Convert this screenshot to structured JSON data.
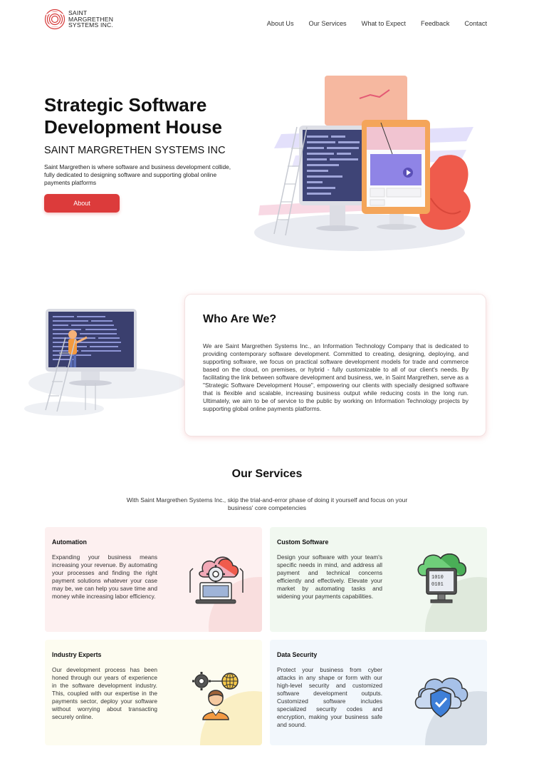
{
  "brand": {
    "line1": "SAINT",
    "line2": "MARGRETHEN",
    "line3": "SYSTEMS INC."
  },
  "nav": {
    "items": [
      "About Us",
      "Our Services",
      "What to Expect",
      "Feedback",
      "Contact"
    ]
  },
  "hero": {
    "title": "Strategic Software Development House",
    "subtitle": "SAINT MARGRETHEN SYSTEMS INC",
    "description": "Saint Margrethen is where software and business development collide, fully dedicated to designing software and supporting global online payments platforms",
    "button_label": "About"
  },
  "who": {
    "title": "Who Are We?",
    "text": "We are Saint Margrethen Systems Inc., an Information Technology Company that is dedicated to providing contemporary software development. Committed to creating, designing, deploying, and supporting software, we focus on practical software development models for trade and commerce based on the cloud, on premises, or hybrid - fully customizable to all of our client's needs. By facilitating the link between software development and business, we, in Saint Margrethen, serve as a \"Strategic Software Development House\", empowering our clients with specially designed software that is flexible and scalable, increasing business output while reducing costs in the long run. Ultimately, we aim to be of service to the public by working on Information Technology projects by supporting global online payments platforms."
  },
  "services": {
    "title": "Our Services",
    "subtitle": "With Saint Margrethen Systems Inc., skip the trial-and-error phase of doing it yourself and focus on your business' core competencies",
    "cards": [
      {
        "title": "Automation",
        "text": "Expanding your business means increasing your revenue. By automating your processes and finding the right payment solutions whatever your case may be, we can help you save time and money while increasing labor efficiency.",
        "icon": "cloud-gear-laptop-icon",
        "accent": "#f7d5d5"
      },
      {
        "title": "Custom Software",
        "text": "Design your software with your team's specific needs in mind, and address all payment and technical concerns efficiently and effectively. Elevate your market by automating tasks and widening your payments capabilities.",
        "icon": "cloud-binary-monitor-icon",
        "accent": "#dfeadc"
      },
      {
        "title": "Industry Experts",
        "text": "Our development process has been honed through our years of experience in the software development industry. This, coupled with our expertise in the payments sector, deploy your software without worrying about transacting securely online.",
        "icon": "developer-gear-globe-icon",
        "accent": "#faf3cf"
      },
      {
        "title": "Data Security",
        "text": "Protect your business from cyber attacks in any shape or form with our high-level security and customized software development outputs. Customized software includes specialized security codes and encryption, making your business safe and sound.",
        "icon": "cloud-shield-icon",
        "accent": "#dde5ee"
      }
    ]
  },
  "colors": {
    "accent_red": "#dc3b3b",
    "text_dark": "#111111"
  }
}
